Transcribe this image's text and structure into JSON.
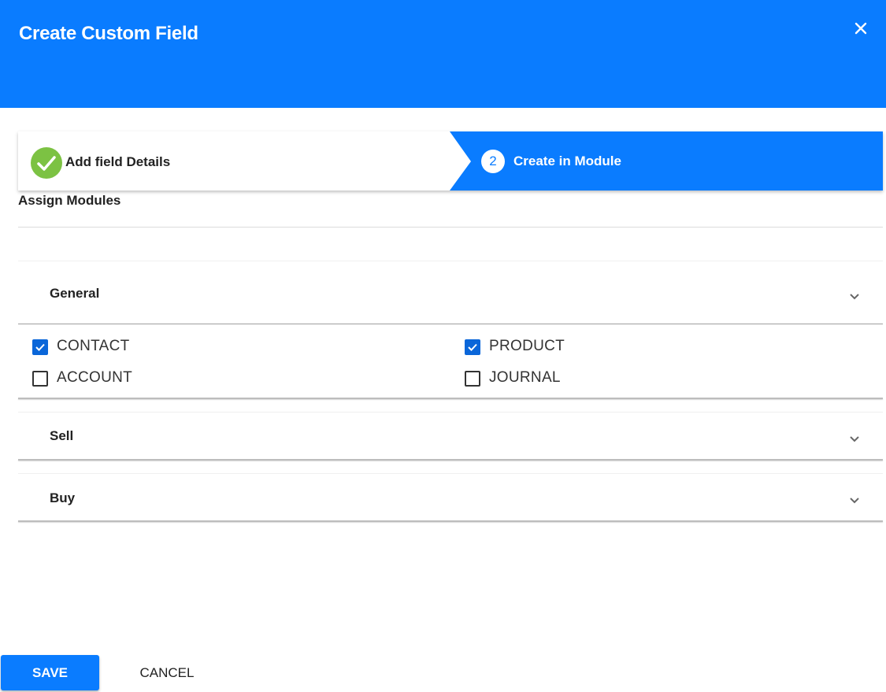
{
  "dialog": {
    "title": "Create Custom Field",
    "accent_color": "#0a7cff",
    "close_icon": "close-icon"
  },
  "stepper": {
    "steps": [
      {
        "label": "Add field Details",
        "status": "completed",
        "icon": "check-circle-icon"
      },
      {
        "number": "2",
        "label": "Create in Module",
        "status": "active"
      }
    ]
  },
  "assign": {
    "title": "Assign Modules"
  },
  "panels": [
    {
      "label": "General",
      "expanded": true,
      "options": [
        {
          "label": "CONTACT",
          "checked": true
        },
        {
          "label": "PRODUCT",
          "checked": true
        },
        {
          "label": "ACCOUNT",
          "checked": false
        },
        {
          "label": "JOURNAL",
          "checked": false
        }
      ]
    },
    {
      "label": "Sell",
      "expanded": false
    },
    {
      "label": "Buy",
      "expanded": false
    }
  ],
  "actions": {
    "save_label": "SAVE",
    "cancel_label": "CANCEL"
  }
}
